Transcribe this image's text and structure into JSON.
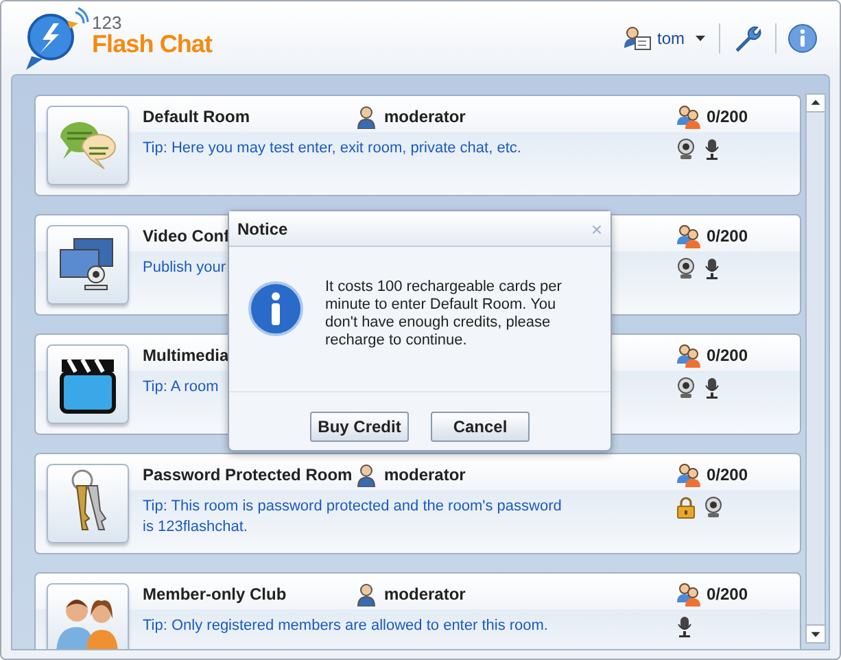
{
  "header": {
    "logo_number": "123",
    "logo_text": "Flash Chat",
    "user": "tom"
  },
  "rooms": [
    {
      "kind": "chat",
      "name": "Default Room",
      "moderator": "moderator",
      "count": "0/200",
      "tip": "Tip: Here you may test enter, exit room, private chat, etc.",
      "media": [
        {
          "kind": "webcam"
        },
        {
          "kind": "mic"
        }
      ]
    },
    {
      "kind": "video",
      "name": "Video Conf",
      "count": "0/200",
      "tip": "Publish your",
      "media": [
        {
          "kind": "webcam"
        },
        {
          "kind": "mic"
        }
      ]
    },
    {
      "kind": "media",
      "name": "Multimedia",
      "count": "0/200",
      "tip": "Tip: A room",
      "media": [
        {
          "kind": "webcam"
        },
        {
          "kind": "mic"
        }
      ]
    },
    {
      "kind": "password",
      "name": "Password Protected Room",
      "moderator": "moderator",
      "count": "0/200",
      "tip": "Tip: This room is password protected and the room's password is 123flashchat.",
      "media": [
        {
          "kind": "lock"
        },
        {
          "kind": "webcam"
        }
      ]
    },
    {
      "kind": "members",
      "name": "Member-only Club",
      "moderator": "moderator",
      "count": "0/200",
      "tip": "Tip: Only registered members are allowed to enter this room.",
      "media": [
        {
          "kind": "mic"
        }
      ]
    }
  ],
  "dialog": {
    "title": "Notice",
    "close": "×",
    "message": "It costs 100 rechargeable cards per minute to enter Default Room. You don't have enough credits, please recharge to continue.",
    "buttons": [
      "Buy Credit",
      "Cancel"
    ]
  }
}
